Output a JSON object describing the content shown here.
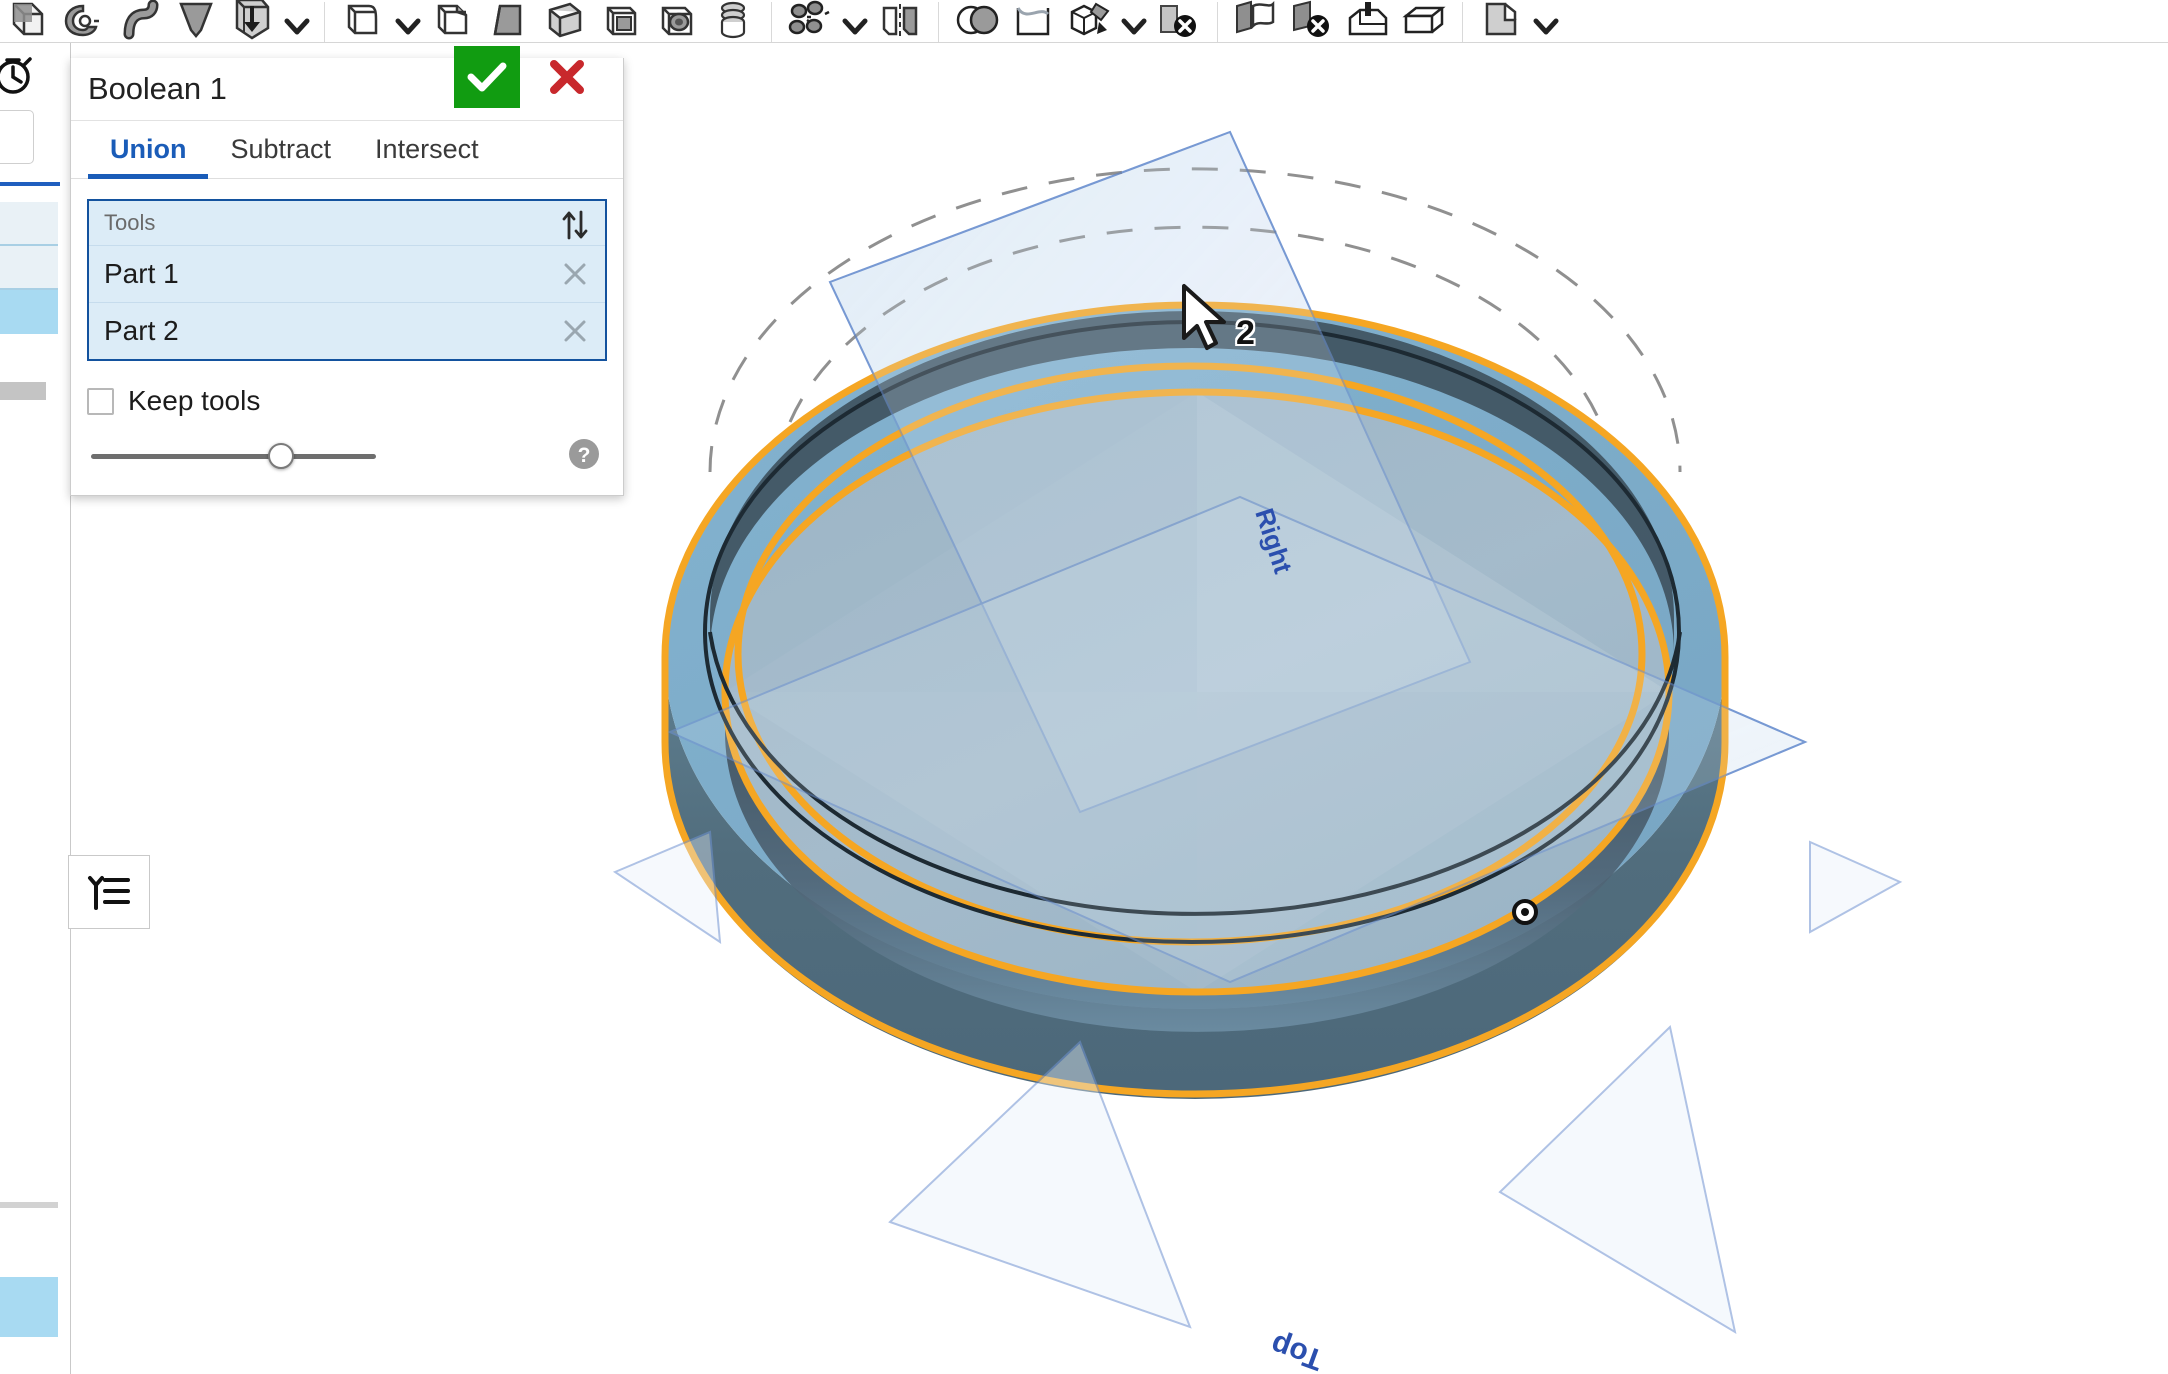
{
  "app": {
    "name": "Onshape",
    "accent_blue": "#1a5cb8",
    "tools_border_blue": "#13529e",
    "tools_fill_blue": "#dcecf7",
    "accept_green": "#119c11",
    "cancel_red": "#c8282c",
    "highlight_orange": "#f5a623",
    "part_body_blue": "#7faecb",
    "part_top_face": "#a2b8c8",
    "part_dark_side": "#54707f",
    "plane_blue": "#4a6fc4"
  },
  "toolbar": {
    "groups": [
      {
        "name": "sketch-and-shape-group",
        "items": [
          {
            "icon": "extrude-box-icon",
            "label": "Extrude"
          },
          {
            "icon": "revolve-icon",
            "label": "Revolve"
          },
          {
            "icon": "sweep-icon",
            "label": "Sweep"
          },
          {
            "icon": "loft-icon",
            "label": "Loft"
          },
          {
            "icon": "thicken-icon",
            "label": "Thicken"
          },
          {
            "icon": "chevron-down-icon",
            "label": "More shape tools"
          }
        ]
      },
      {
        "name": "modify-group",
        "items": [
          {
            "icon": "fillet-icon",
            "label": "Fillet"
          },
          {
            "icon": "chevron-down-icon",
            "label": "More fillet tools"
          },
          {
            "icon": "chamfer-icon",
            "label": "Chamfer"
          },
          {
            "icon": "draft-icon",
            "label": "Draft"
          },
          {
            "icon": "rib-icon",
            "label": "Rib"
          },
          {
            "icon": "shell-icon",
            "label": "Shell"
          },
          {
            "icon": "hole-icon",
            "label": "Hole"
          },
          {
            "icon": "thread-icon",
            "label": "Thread"
          }
        ]
      },
      {
        "name": "pattern-group",
        "items": [
          {
            "icon": "pattern-icon",
            "label": "Pattern"
          },
          {
            "icon": "chevron-down-icon",
            "label": "More pattern tools"
          },
          {
            "icon": "mirror-icon",
            "label": "Mirror"
          }
        ]
      },
      {
        "name": "boolean-group",
        "items": [
          {
            "icon": "boolean-icon",
            "label": "Boolean"
          },
          {
            "icon": "split-icon",
            "label": "Split"
          },
          {
            "icon": "transform-icon",
            "label": "Transform"
          },
          {
            "icon": "chevron-down-icon",
            "label": "More boolean tools"
          },
          {
            "icon": "delete-face-icon",
            "label": "Delete face"
          }
        ]
      },
      {
        "name": "surface-group",
        "items": [
          {
            "icon": "move-face-icon",
            "label": "Move face"
          },
          {
            "icon": "delete-part-icon",
            "label": "Delete part"
          },
          {
            "icon": "enclose-icon",
            "label": "Enclose"
          },
          {
            "icon": "boundingbox-icon",
            "label": "Bounding box"
          }
        ]
      },
      {
        "name": "assembly-group",
        "items": [
          {
            "icon": "sheet-metal-icon",
            "label": "Sheet metal"
          },
          {
            "icon": "chevron-down-icon",
            "label": "More tools"
          }
        ]
      }
    ]
  },
  "left_rail": {
    "history_icon": "history-clock-icon",
    "search_field_placeholder": "",
    "feature_tree_toggle_icon": "feature-list-icon",
    "tree_rows": [
      {
        "name": "feature-row-1",
        "state": "tinted"
      },
      {
        "name": "feature-row-2",
        "state": "tinted"
      },
      {
        "name": "feature-row-3",
        "state": "selected"
      },
      {
        "name": "feature-row-4",
        "state": "blank"
      }
    ],
    "bottom_selected_row": {
      "name": "feature-row-bottom",
      "state": "selected"
    }
  },
  "dialog": {
    "title": "Boolean 1",
    "accept_icon": "checkmark-icon",
    "accept_label": "Accept",
    "cancel_icon": "close-x-icon",
    "cancel_label": "Cancel",
    "tabs": [
      {
        "label": "Union",
        "active": true
      },
      {
        "label": "Subtract",
        "active": false
      },
      {
        "label": "Intersect",
        "active": false
      }
    ],
    "tools_section": {
      "label": "Tools",
      "sort_icon": "sort-arrows-icon",
      "sort_label": "Reorder tools",
      "entries": [
        {
          "label": "Part 1",
          "remove_icon": "close-x-icon"
        },
        {
          "label": "Part 2",
          "remove_icon": "close-x-icon"
        }
      ]
    },
    "keep_tools": {
      "label": "Keep tools",
      "checked": false
    },
    "footer": {
      "slider_value": 62,
      "slider_label": "Transparency",
      "help_icon": "question-mark-icon",
      "help_label": "Help"
    }
  },
  "viewport": {
    "plane_labels": [
      {
        "text": "Right",
        "name": "plane-label-right"
      },
      {
        "text": "Top",
        "name": "plane-label-top"
      }
    ],
    "origin_marker": "origin-point-icon",
    "selection_count_badge": "2",
    "cursor_icon": "mouse-pointer-icon"
  }
}
